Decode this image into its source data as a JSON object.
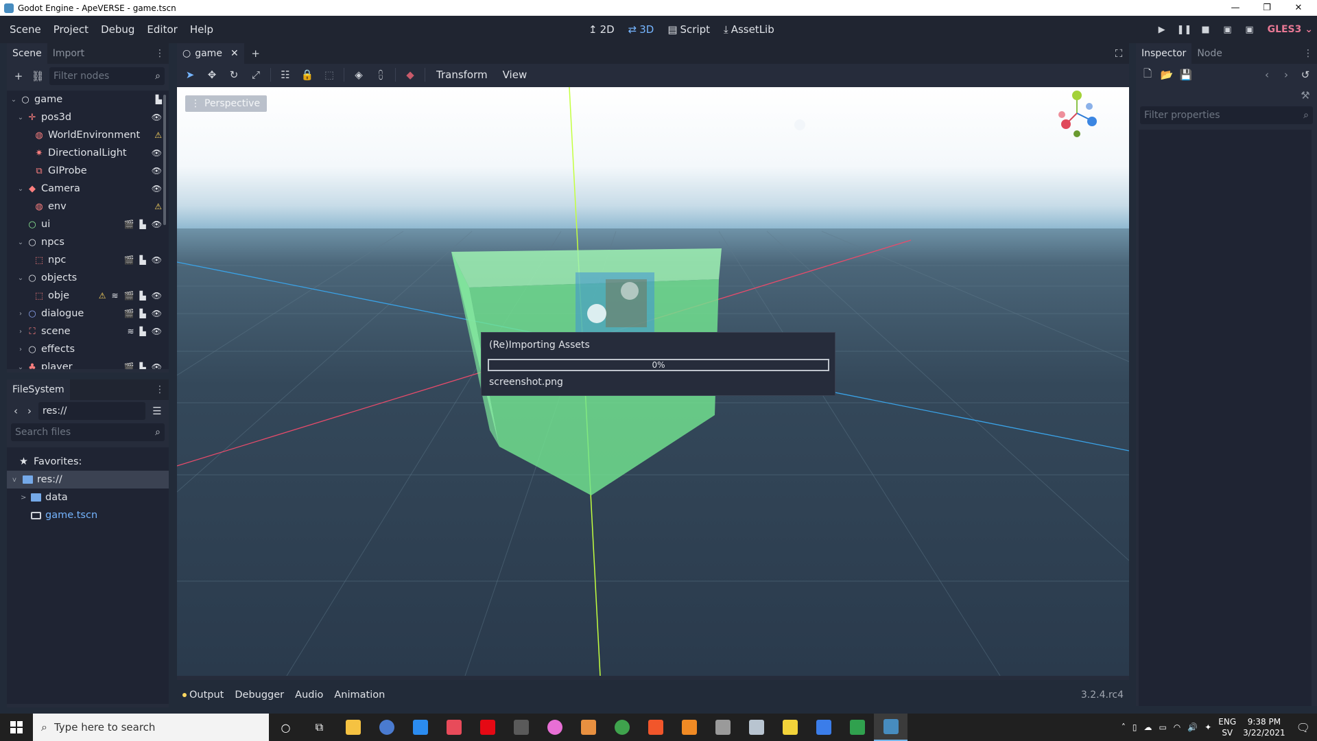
{
  "window": {
    "title": "Godot Engine - ApeVERSE - game.tscn",
    "controls": [
      "—",
      "❐",
      "✕"
    ]
  },
  "menu": [
    "Scene",
    "Project",
    "Debug",
    "Editor",
    "Help"
  ],
  "main_screens": [
    {
      "label": "2D",
      "icon": "2d-icon"
    },
    {
      "label": "3D",
      "icon": "3d-icon",
      "active": true
    },
    {
      "label": "Script",
      "icon": "script-icon"
    },
    {
      "label": "AssetLib",
      "icon": "assetlib-icon"
    }
  ],
  "renderer": "GLES3",
  "scene_dock": {
    "tabs": [
      "Scene",
      "Import"
    ],
    "filter_placeholder": "Filter nodes",
    "nodes": [
      {
        "label": "game",
        "depth": 0,
        "arrow": "v",
        "icon": "○",
        "icon_color": "#e0e3e8",
        "badges": [
          "script"
        ]
      },
      {
        "label": "pos3d",
        "depth": 1,
        "arrow": "v",
        "icon": "✛",
        "icon_color": "#fc7f7f",
        "badges": [
          "eye"
        ]
      },
      {
        "label": "WorldEnvironment",
        "depth": 2,
        "arrow": "",
        "icon": "◍",
        "icon_color": "#fc7f7f",
        "badges": [
          "warn"
        ]
      },
      {
        "label": "DirectionalLight",
        "depth": 2,
        "arrow": "",
        "icon": "✷",
        "icon_color": "#fc7f7f",
        "badges": [
          "eye"
        ]
      },
      {
        "label": "GIProbe",
        "depth": 2,
        "arrow": "",
        "icon": "⧉",
        "icon_color": "#fc7f7f",
        "badges": [
          "eye"
        ]
      },
      {
        "label": "Camera",
        "depth": 1,
        "arrow": "v",
        "icon": "◆",
        "icon_color": "#fc7f7f",
        "badges": [
          "eye"
        ]
      },
      {
        "label": "env",
        "depth": 2,
        "arrow": "",
        "icon": "◍",
        "icon_color": "#fc7f7f",
        "badges": [
          "warn"
        ]
      },
      {
        "label": "ui",
        "depth": 1,
        "arrow": "",
        "icon": "○",
        "icon_color": "#8eef97",
        "badges": [
          "clapper",
          "script",
          "eye"
        ]
      },
      {
        "label": "npcs",
        "depth": 1,
        "arrow": "v",
        "icon": "○",
        "icon_color": "#e0e3e8",
        "badges": []
      },
      {
        "label": "npc",
        "depth": 2,
        "arrow": "",
        "icon": "⬚",
        "icon_color": "#fc7f7f",
        "badges": [
          "clapper",
          "script",
          "eye"
        ]
      },
      {
        "label": "objects",
        "depth": 1,
        "arrow": "v",
        "icon": "○",
        "icon_color": "#e0e3e8",
        "badges": []
      },
      {
        "label": "obje",
        "depth": 2,
        "arrow": "",
        "icon": "⬚",
        "icon_color": "#fc7f7f",
        "badges": [
          "warn",
          "signal",
          "clapper",
          "script",
          "eye"
        ]
      },
      {
        "label": "dialogue",
        "depth": 1,
        "arrow": ">",
        "icon": "○",
        "icon_color": "#8da5f3",
        "badges": [
          "clapper",
          "script",
          "eye"
        ]
      },
      {
        "label": "scene",
        "depth": 1,
        "arrow": ">",
        "icon": "⛶",
        "icon_color": "#fc7f7f",
        "badges": [
          "signal",
          "script",
          "eye"
        ]
      },
      {
        "label": "effects",
        "depth": 1,
        "arrow": ">",
        "icon": "○",
        "icon_color": "#e0e3e8",
        "badges": []
      },
      {
        "label": "player",
        "depth": 1,
        "arrow": "v",
        "icon": "♣",
        "icon_color": "#fc7f7f",
        "badges": [
          "clapper",
          "script",
          "eye"
        ]
      }
    ]
  },
  "filesystem": {
    "tab": "FileSystem",
    "path": "res://",
    "search_placeholder": "Search files",
    "items": [
      {
        "label": "Favorites:",
        "icon": "★",
        "depth": 0,
        "type": "header"
      },
      {
        "label": "res://",
        "icon": "folder",
        "depth": 0,
        "arrow": "v",
        "selected": true
      },
      {
        "label": "data",
        "icon": "folder",
        "depth": 1,
        "arrow": ">"
      },
      {
        "label": "game.tscn",
        "icon": "scene",
        "depth": 1,
        "arrow": "",
        "color": "#75b5ff"
      }
    ]
  },
  "editor": {
    "scene_tab": "game",
    "viewport_menus": [
      "Transform",
      "View"
    ],
    "perspective_label": "Perspective"
  },
  "import_dialog": {
    "title": "(Re)Importing Assets",
    "progress": 0,
    "progress_text": "0%",
    "file": "screenshot.png"
  },
  "bottom_panel": {
    "tabs": [
      "Output",
      "Debugger",
      "Audio",
      "Animation"
    ],
    "version": "3.2.4.rc4"
  },
  "inspector": {
    "tabs": [
      "Inspector",
      "Node"
    ],
    "filter_placeholder": "Filter properties"
  },
  "taskbar": {
    "search_placeholder": "Type here to search",
    "apps": [
      {
        "name": "cortana-icon",
        "color": "#202020",
        "glyph": "○"
      },
      {
        "name": "task-view-icon",
        "color": "#202020",
        "glyph": "⧉"
      },
      {
        "name": "file-explorer-icon",
        "color": "#f5c242"
      },
      {
        "name": "qbittorrent-icon",
        "color": "#4a7bd0"
      },
      {
        "name": "cloud-app-icon",
        "color": "#2b8cf0"
      },
      {
        "name": "game-launcher-icon",
        "color": "#e84b5a"
      },
      {
        "name": "netflix-icon",
        "color": "#e50914"
      },
      {
        "name": "game-app-icon",
        "color": "#5a5a5a"
      },
      {
        "name": "paint-app-icon",
        "color": "#e86fd5"
      },
      {
        "name": "pen-app-icon",
        "color": "#e89040"
      },
      {
        "name": "chrome-icon",
        "color": "#3fa34d"
      },
      {
        "name": "brave-icon",
        "color": "#f1562b"
      },
      {
        "name": "blender-icon",
        "color": "#f08a24"
      },
      {
        "name": "clapper-app-icon",
        "color": "#9a9a9a"
      },
      {
        "name": "image-viewer-icon",
        "color": "#b8c4d0"
      },
      {
        "name": "sticky-notes-icon",
        "color": "#f2d33a"
      },
      {
        "name": "docs-icon",
        "color": "#3b7de9"
      },
      {
        "name": "sheets-icon",
        "color": "#30a14e"
      },
      {
        "name": "godot-icon",
        "color": "#478cbf",
        "active": true
      }
    ],
    "lang": [
      "ENG",
      "SV"
    ],
    "time": "9:38 PM",
    "date": "3/22/2021"
  }
}
